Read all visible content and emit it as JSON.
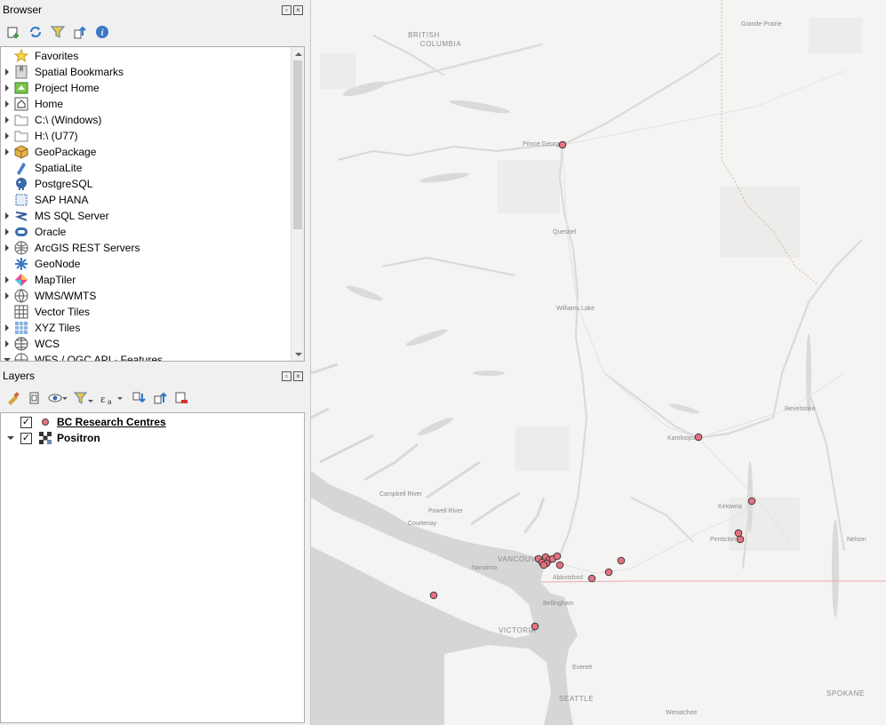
{
  "browser": {
    "title": "Browser",
    "toolbar": [
      "add-layer-icon",
      "refresh-icon",
      "filter-icon",
      "collapse-icon",
      "info-icon"
    ],
    "items": [
      {
        "label": "Favorites",
        "expand": false,
        "icon": "star-icon"
      },
      {
        "label": "Spatial Bookmarks",
        "expand": true,
        "icon": "bookmarks-icon"
      },
      {
        "label": "Project Home",
        "expand": true,
        "icon": "project-home-icon"
      },
      {
        "label": "Home",
        "expand": true,
        "icon": "home-icon"
      },
      {
        "label": "C:\\ (Windows)",
        "expand": true,
        "icon": "folder-icon"
      },
      {
        "label": "H:\\ (U77)",
        "expand": true,
        "icon": "folder-icon"
      },
      {
        "label": "GeoPackage",
        "expand": true,
        "icon": "geopackage-icon"
      },
      {
        "label": "SpatiaLite",
        "expand": false,
        "icon": "spatialite-icon"
      },
      {
        "label": "PostgreSQL",
        "expand": false,
        "icon": "postgresql-icon"
      },
      {
        "label": "SAP HANA",
        "expand": false,
        "icon": "sap-hana-icon"
      },
      {
        "label": "MS SQL Server",
        "expand": true,
        "icon": "mssql-icon"
      },
      {
        "label": "Oracle",
        "expand": true,
        "icon": "oracle-icon"
      },
      {
        "label": "ArcGIS REST Servers",
        "expand": true,
        "icon": "arcgis-icon"
      },
      {
        "label": "GeoNode",
        "expand": false,
        "icon": "geonode-icon"
      },
      {
        "label": "MapTiler",
        "expand": true,
        "icon": "maptiler-icon"
      },
      {
        "label": "WMS/WMTS",
        "expand": true,
        "icon": "wms-icon"
      },
      {
        "label": "Vector Tiles",
        "expand": false,
        "icon": "vector-tiles-icon"
      },
      {
        "label": "XYZ Tiles",
        "expand": true,
        "icon": "xyz-tiles-icon"
      },
      {
        "label": "WCS",
        "expand": true,
        "icon": "wcs-icon"
      },
      {
        "label": "WFS / OGC API - Features",
        "expand": "down",
        "icon": "wfs-icon"
      }
    ]
  },
  "layers": {
    "title": "Layers",
    "toolbar": [
      "style-icon",
      "add-group-icon",
      "visibility-icon",
      "filter-legend-icon",
      "expression-filter-icon",
      "expand-all-icon",
      "collapse-all-icon",
      "remove-layer-icon"
    ],
    "items": [
      {
        "label": "BC Research Centres",
        "checked": true,
        "active": true,
        "icon": "point-symbol-icon"
      },
      {
        "label": "Positron",
        "checked": true,
        "active": false,
        "icon": "raster-tile-icon"
      }
    ]
  },
  "map": {
    "labels": {
      "bc1": "BRITISH",
      "bc2": "COLUMBIA",
      "grande_prairie": "Grande Prairie",
      "prince_george": "Prince George",
      "quesnel": "Quesnel",
      "williams_lake": "Williams Lake",
      "revelstoke": "Revelstoke",
      "kamloops": "Kamloops",
      "kelowna": "Kelowna",
      "penticton": "Penticton",
      "nelson": "Nelson",
      "campbell_river": "Campbell River",
      "powell_river": "Powell River",
      "courtenay": "Courtenay",
      "vancouver": "VANCOUVER",
      "nanaimo": "Nanaimo",
      "abbotsford": "Abbotsford",
      "bellingham": "Bellingham",
      "victoria": "VICTORIA",
      "everett": "Everett",
      "seattle": "SEATTLE",
      "wenatchee": "Wenatchee",
      "spokane": "SPOKANE"
    },
    "point_color": "#e8717f",
    "point_stroke": "#3a3a3a"
  }
}
